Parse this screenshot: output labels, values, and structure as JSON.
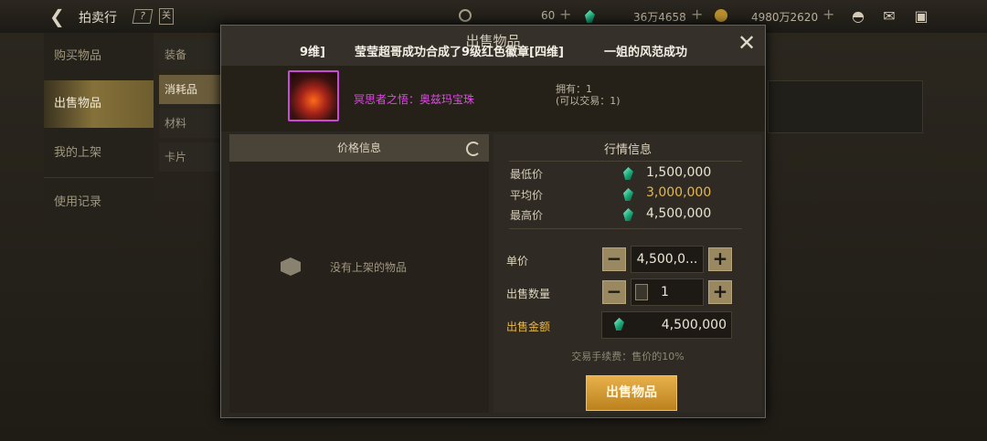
{
  "topbar": {
    "title": "拍卖行",
    "help": "?",
    "calendar": "关",
    "res1_value": "60",
    "res2_value": "36万4658",
    "res3_value": "4980万2620",
    "plus": "+"
  },
  "nav": {
    "items": [
      "购买物品",
      "出售物品",
      "我的上架",
      "使用记录"
    ],
    "active_index": 1
  },
  "categories": [
    "装备",
    "消耗品",
    "材料",
    "卡片"
  ],
  "dialog": {
    "title": "出售物品",
    "marquee": {
      "left": "9维]",
      "middle": "莹莹超哥成功合成了9级红色徽章[四维]",
      "right": "一姐的风范成功"
    },
    "close": "✕",
    "item": {
      "name": "冥思者之悟：奥兹玛宝珠",
      "owned": "拥有：1",
      "tradable": "(可以交易：1)"
    },
    "price_info": {
      "header": "价格信息",
      "empty_text": "没有上架的物品"
    },
    "market": {
      "header": "行情信息",
      "rows": [
        {
          "label": "最低价",
          "value": "1,500,000"
        },
        {
          "label": "平均价",
          "value": "3,000,000"
        },
        {
          "label": "最高价",
          "value": "4,500,000"
        }
      ]
    },
    "form": {
      "unit_price_label": "单价",
      "unit_price_value": "4,500,0...",
      "quantity_label": "出售数量",
      "quantity_value": "1",
      "total_label": "出售金额",
      "total_value": "4,500,000",
      "minus": "−",
      "plus": "+"
    },
    "fee_text": "交易手续费：售价的10%",
    "sell_button": "出售物品"
  },
  "colors": {
    "accent_gold": "#e8b84a",
    "item_purple": "#e04ae6",
    "gem_teal": "#1aa978"
  }
}
